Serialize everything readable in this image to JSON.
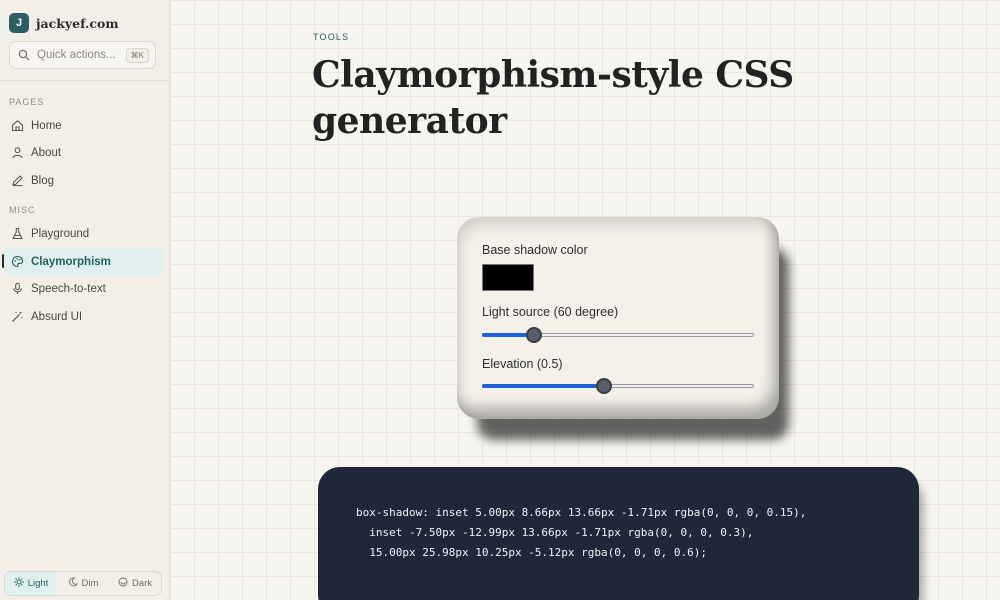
{
  "sidebar": {
    "brand": {
      "logo_letter": "J",
      "name": "jackyef.com"
    },
    "quick_actions": {
      "placeholder": "Quick actions...",
      "shortcut": "⌘K"
    },
    "sections": [
      {
        "label": "PAGES",
        "items": [
          {
            "label": "Home",
            "icon": "home-icon"
          },
          {
            "label": "About",
            "icon": "user-icon"
          },
          {
            "label": "Blog",
            "icon": "pencil-icon"
          }
        ]
      },
      {
        "label": "MISC",
        "items": [
          {
            "label": "Playground",
            "icon": "flask-icon"
          },
          {
            "label": "Claymorphism",
            "icon": "palette-icon",
            "active": true
          },
          {
            "label": "Speech-to-text",
            "icon": "microphone-icon"
          },
          {
            "label": "Absurd UI",
            "icon": "magic-wand-icon"
          }
        ]
      }
    ],
    "theme": {
      "options": [
        "Light",
        "Dim",
        "Dark"
      ],
      "selected": "Light"
    }
  },
  "main": {
    "eyebrow": "TOOLS",
    "title": "Claymorphism-style CSS generator",
    "controls": {
      "shadow_color_label": "Base shadow color",
      "shadow_color_value": "#000000",
      "light_source_label": "Light source (60 degree)",
      "light_source_degree": 60,
      "light_source_fraction": 0.19,
      "elevation_label": "Elevation (0.5)",
      "elevation_value": 0.5,
      "elevation_fraction": 0.45
    },
    "code": {
      "lines": [
        "box-shadow: inset 5.00px 8.66px 13.66px -1.71px rgba(0, 0, 0, 0.15),",
        "  inset -7.50px -12.99px 13.66px -1.71px rgba(0, 0, 0, 0.3),",
        "  15.00px 25.98px 10.25px -5.12px rgba(0, 0, 0, 0.6);"
      ]
    }
  },
  "colors": {
    "accent": "#2e5e64",
    "active_bg": "#dff0ee",
    "slider_fill": "#1a62d6",
    "code_bg": "#1e2838"
  }
}
